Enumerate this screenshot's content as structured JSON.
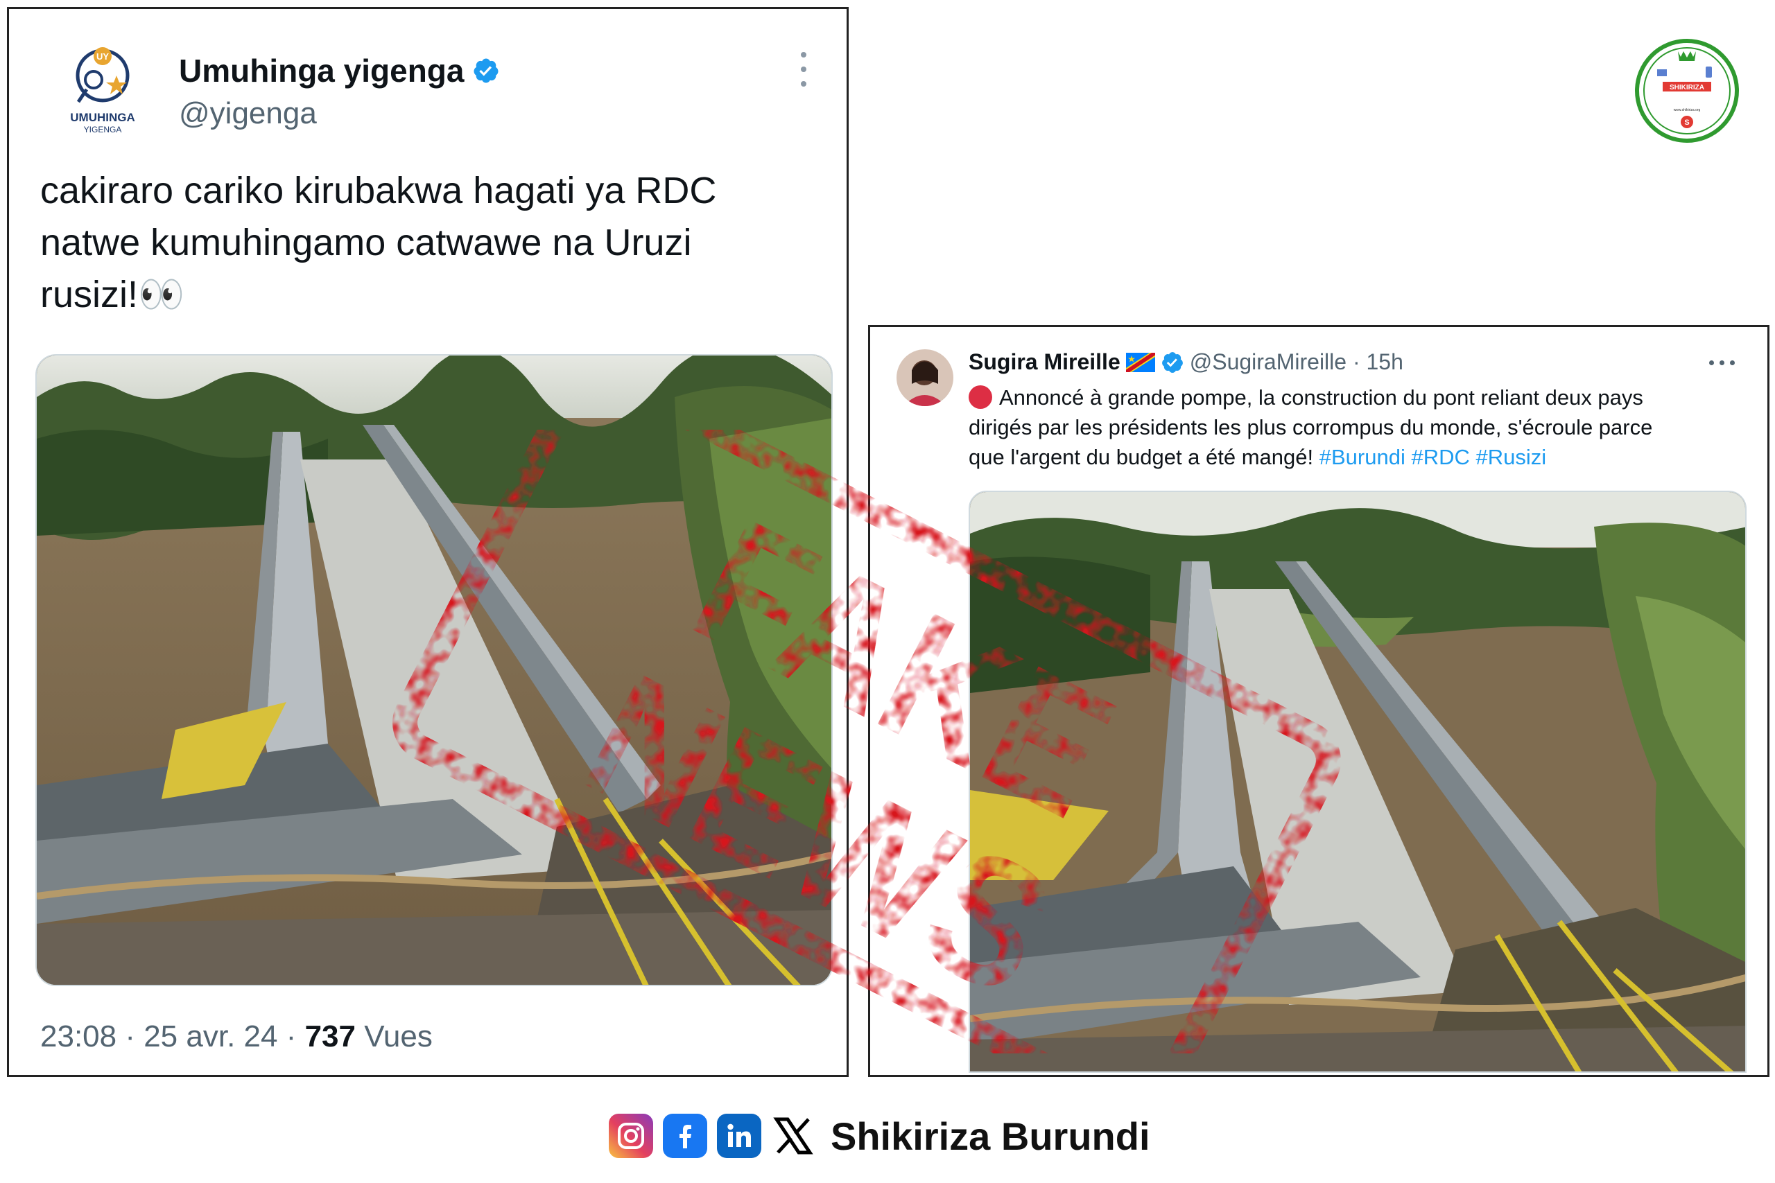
{
  "tweet_left": {
    "author_name": "Umuhinga yigenga",
    "author_handle": "@yigenga",
    "avatar_text_main": "UMUHINGA",
    "avatar_text_sub": "YIGENGA",
    "avatar_badge": "UY",
    "text_lines": [
      "cakiraro cariko kirubakwa hagati ya RDC",
      "natwe kumuhingamo catwawe na Uruzi",
      "rusizi!👀"
    ],
    "time": "23:08 · 25 avr. 24 · ",
    "views_count": "737",
    "views_label": " Vues"
  },
  "tweet_right": {
    "author_name": "Sugira Mireille",
    "author_handle": "@SugiraMireille · 15h",
    "text_lines": [
      "Annoncé à grande pompe, la construction du pont reliant deux pays",
      "dirigés par les  présidents  les plus corrompus du monde, s'écroule parce",
      "que l'argent du budget a été mangé! "
    ],
    "hashtags": "#Burundi #RDC #Rusizi"
  },
  "stamp": {
    "line1": "FAKE",
    "line2": "NEWS"
  },
  "logo": {
    "name": "SHIKIRIZA",
    "url": "www.shikiriza.org"
  },
  "footer": {
    "brand": "Shikiriza Burundi",
    "icons": [
      "instagram-icon",
      "facebook-icon",
      "linkedin-icon",
      "x-icon"
    ]
  },
  "colors": {
    "verified": "#1d9bf0",
    "stamp_red": "#d7141c",
    "hashtag": "#1d9bf0",
    "muted": "#536471"
  }
}
